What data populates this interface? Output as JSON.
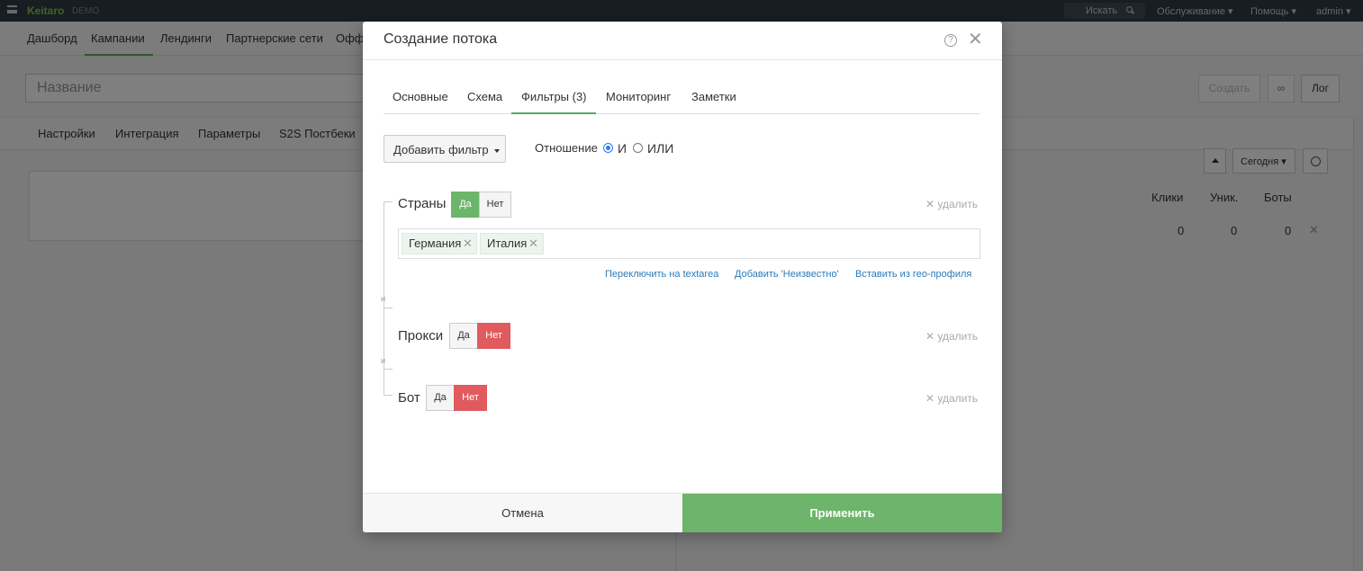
{
  "topbar": {
    "brand": "Keitaro",
    "demo": "DEMO",
    "search_label": "Искать",
    "menu": [
      "Обслуживание ▾",
      "Помощь ▾",
      "admin ▾"
    ]
  },
  "nav": {
    "items": [
      "Дашборд",
      "Кампании",
      "Лендинги",
      "Партнерские сети",
      "Офф"
    ],
    "active": "Кампании"
  },
  "campaign": {
    "name_placeholder": "Название",
    "create_label": "Создать",
    "link_icon": "link-icon",
    "log_label": "Лог"
  },
  "subnav": {
    "items": [
      "Настройки",
      "Интеграция",
      "Параметры",
      "S2S Постбеки"
    ]
  },
  "report": {
    "period_label": "Сегодня ▾",
    "columns": [
      "Клики",
      "Уник.",
      "Боты"
    ],
    "row": [
      "0",
      "0",
      "0"
    ],
    "row_remove": "✕"
  },
  "modal": {
    "title": "Создание потока",
    "help": "?",
    "close": "✕",
    "tabs": [
      "Основные",
      "Схема",
      "Фильтры (3)",
      "Мониторинг",
      "Заметки"
    ],
    "active_tab": "Фильтры (3)",
    "add_filter_label": "Добавить фильтр",
    "relation": {
      "label": "Отношение",
      "options": [
        "И",
        "ИЛИ"
      ],
      "selected": "И"
    },
    "and_mark": "и",
    "yes_label": "Да",
    "no_label": "Нет",
    "remove_label": "✕ удалить",
    "filters": [
      {
        "name": "Страны",
        "state": "Да",
        "tags": [
          "Германия",
          "Италия"
        ],
        "tag_remove": "✕",
        "links": [
          "Переключить на textarea",
          "Добавить 'Неизвестно'",
          "Вставить из гео-профиля"
        ]
      },
      {
        "name": "Прокси",
        "state": "Нет"
      },
      {
        "name": "Бот",
        "state": "Нет"
      }
    ],
    "footer": {
      "cancel_label": "Отмена",
      "apply_label": "Применить"
    }
  },
  "colors": {
    "accent_green": "#6cb56b",
    "danger_red": "#e05a5e",
    "link_blue": "#2b7bb9",
    "topbar": "#2f3a43"
  }
}
